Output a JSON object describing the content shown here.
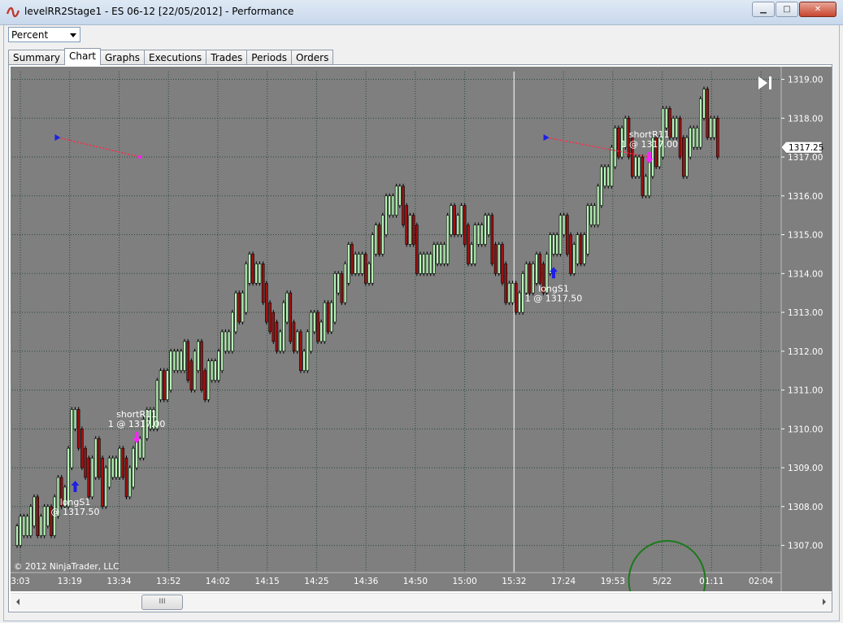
{
  "window": {
    "title": "levelRR2Stage1 - ES 06-12 [22/05/2012] - Performance",
    "minimize_glyph": "▁",
    "maximize_glyph": "□",
    "close_glyph": "✕"
  },
  "toolbar": {
    "display_unit": "Percent"
  },
  "tabs": [
    {
      "label": "Summary"
    },
    {
      "label": "Chart"
    },
    {
      "label": "Graphs"
    },
    {
      "label": "Executions"
    },
    {
      "label": "Trades"
    },
    {
      "label": "Periods"
    },
    {
      "label": "Orders"
    }
  ],
  "active_tab": "Chart",
  "scrollbar": {
    "thumb_glyph": "III"
  },
  "colors": {
    "chart_background": "#7f7f7f",
    "up_bar": "#b7f3b7",
    "down_bar": "#a01010",
    "grid": "#2a4a3a",
    "long_marker": "#1e1ee8",
    "short_marker": "#ff22ff",
    "annotation_circle": "#1a7a1a"
  },
  "chart_data": {
    "type": "candlestick",
    "copyright": "© 2012 NinjaTrader, LLC",
    "current_price_label": "1317.25",
    "current_price": 1317.25,
    "ylim": [
      1306.3,
      1319.2
    ],
    "y_ticks": [
      "1307.00",
      "1308.00",
      "1309.00",
      "1310.00",
      "1311.00",
      "1312.00",
      "1313.00",
      "1314.00",
      "1315.00",
      "1316.00",
      "1317.00",
      "1318.00",
      "1319.00"
    ],
    "x_ticks": [
      "3:03",
      "13:19",
      "13:34",
      "13:52",
      "14:02",
      "14:15",
      "14:25",
      "14:36",
      "14:50",
      "15:00",
      "15:32",
      "17:24",
      "19:53",
      "5/22",
      "01:11",
      "02:04"
    ],
    "session_break_index": 10,
    "close_path": [
      [
        0,
        1307.25
      ],
      [
        4,
        1307.75
      ],
      [
        8,
        1307.5
      ],
      [
        11,
        1308.0
      ],
      [
        14,
        1308.5
      ],
      [
        15,
        1309.25
      ],
      [
        16,
        1310.0
      ],
      [
        17,
        1310.5
      ],
      [
        18,
        1310.0
      ],
      [
        19,
        1309.0
      ],
      [
        21,
        1308.75
      ],
      [
        23,
        1309.25
      ],
      [
        25,
        1308.5
      ],
      [
        27,
        1308.75
      ],
      [
        29,
        1309.25
      ],
      [
        31,
        1308.75
      ],
      [
        33,
        1308.75
      ],
      [
        35,
        1309.5
      ],
      [
        37,
        1310.0
      ],
      [
        39,
        1310.25
      ],
      [
        41,
        1310.75
      ],
      [
        43,
        1311.25
      ],
      [
        45,
        1311.5
      ],
      [
        47,
        1312.0
      ],
      [
        49,
        1311.75
      ],
      [
        51,
        1311.5
      ],
      [
        53,
        1311.75
      ],
      [
        55,
        1311.25
      ],
      [
        57,
        1311.5
      ],
      [
        59,
        1311.75
      ],
      [
        61,
        1312.25
      ],
      [
        63,
        1312.75
      ],
      [
        65,
        1313.25
      ],
      [
        67,
        1313.75
      ],
      [
        69,
        1314.25
      ],
      [
        71,
        1313.75
      ],
      [
        73,
        1313.25
      ],
      [
        75,
        1312.25
      ],
      [
        77,
        1312.5
      ],
      [
        79,
        1313.0
      ],
      [
        81,
        1312.5
      ],
      [
        83,
        1311.75
      ],
      [
        85,
        1312.25
      ],
      [
        87,
        1312.75
      ],
      [
        89,
        1312.5
      ],
      [
        91,
        1313.0
      ],
      [
        93,
        1313.5
      ],
      [
        95,
        1313.75
      ],
      [
        97,
        1314.25
      ],
      [
        99,
        1314.5
      ],
      [
        101,
        1314.0
      ],
      [
        103,
        1314.25
      ],
      [
        105,
        1314.75
      ],
      [
        107,
        1315.25
      ],
      [
        109,
        1315.75
      ],
      [
        111,
        1316.0
      ],
      [
        113,
        1315.5
      ],
      [
        115,
        1315.0
      ],
      [
        117,
        1314.5
      ],
      [
        119,
        1314.0
      ],
      [
        121,
        1314.5
      ],
      [
        123,
        1314.25
      ],
      [
        125,
        1314.75
      ],
      [
        127,
        1315.25
      ],
      [
        129,
        1315.5
      ],
      [
        131,
        1315.0
      ],
      [
        133,
        1314.5
      ],
      [
        135,
        1315.0
      ],
      [
        137,
        1315.25
      ],
      [
        139,
        1314.75
      ],
      [
        141,
        1314.25
      ],
      [
        143,
        1313.75
      ],
      [
        145,
        1313.25
      ],
      [
        147,
        1313.5
      ],
      [
        149,
        1313.75
      ],
      [
        151,
        1314.25
      ],
      [
        153,
        1313.75
      ],
      [
        155,
        1314.25
      ],
      [
        157,
        1314.75
      ],
      [
        159,
        1315.25
      ],
      [
        161,
        1314.75
      ],
      [
        163,
        1314.25
      ],
      [
        165,
        1314.75
      ],
      [
        167,
        1315.25
      ],
      [
        169,
        1315.75
      ],
      [
        171,
        1316.25
      ],
      [
        173,
        1316.75
      ],
      [
        175,
        1317.25
      ],
      [
        177,
        1317.75
      ],
      [
        179,
        1317.25
      ],
      [
        181,
        1316.75
      ],
      [
        183,
        1316.25
      ],
      [
        185,
        1316.75
      ],
      [
        187,
        1317.25
      ],
      [
        189,
        1317.75
      ],
      [
        191,
        1318.0
      ],
      [
        193,
        1317.5
      ],
      [
        195,
        1317.0
      ],
      [
        197,
        1317.25
      ],
      [
        199,
        1317.75
      ],
      [
        201,
        1318.25
      ],
      [
        203,
        1317.75
      ],
      [
        205,
        1317.25
      ]
    ],
    "trades": [
      {
        "type": "long",
        "name": "longS1",
        "detail": "@ 1317.50",
        "bar": 17,
        "price": 1308.5,
        "side_label_above": false
      },
      {
        "type": "short",
        "name": "shortR11",
        "detail": "1 @ 1317.00",
        "bar": 35,
        "price": 1309.8,
        "side_label_above": true
      },
      {
        "type": "long",
        "name": "longS1",
        "detail": "1 @ 1317.50",
        "bar": 157,
        "price": 1314.0,
        "side_label_above": false
      },
      {
        "type": "short",
        "name": "shortR11",
        "detail": "1 @ 1317.00",
        "bar": 185,
        "price": 1317.0,
        "side_label_above": true
      }
    ],
    "trade_lines": [
      {
        "from_bar": 12,
        "from_price": 1317.5,
        "to_bar": 36,
        "to_price": 1317.0
      },
      {
        "from_bar": 155,
        "from_price": 1317.5,
        "to_bar": 185,
        "to_price": 1317.0
      }
    ],
    "annotation_circle_around_tick": "5/22"
  }
}
